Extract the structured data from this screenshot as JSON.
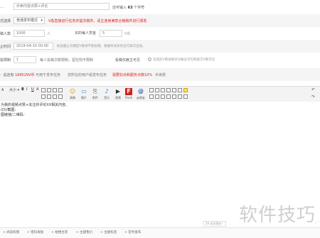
{
  "form": {
    "title_row": {
      "label": "…",
      "value": "外卖内容点赞+评论",
      "counter_prefix": "还可输入",
      "counter_value": "63",
      "counter_suffix": "个字符"
    },
    "mode_row": {
      "label": "式选择",
      "select_value": "普通发布模式",
      "warning": "V看直接进行任务并提交稿件，请主连续满意合格稿件进行颁发"
    },
    "count_row": {
      "label": "稿人数",
      "input_value": "1000",
      "unit": "人",
      "reward_label": "买的每人赏金",
      "reward_value": "5",
      "reward_unit": "V币"
    },
    "deadline_row": {
      "label": "止时间",
      "input_value": "2019-04-10 00:00",
      "note": "如此截止日期后V看将不能投稿，看截时间未有任可再次追加。"
    },
    "limit_row": {
      "label": "投限制",
      "input_value": "1",
      "note": "每人投稿次数限制，留空则不限制",
      "option_label": "投稿仅雇主可见",
      "option_note": "勾选后V看投稿仅对雇主可见和提交V看可见"
    },
    "fee_row": {
      "label": "总还有",
      "amount": "168529V币",
      "amount_note": "可用于发布任务",
      "fee_note": "您所在的用户组发布任务",
      "fee_red": "需要扣点和服务点数10%",
      "fee_tail": "手续费"
    }
  },
  "toolbar": {
    "row1": [
      "大小",
      "B",
      "I",
      "U",
      "A",
      "≡",
      "≡",
      "≡",
      "≡",
      "⁝",
      "≡",
      "🔗",
      "♪",
      "▦",
      "☻"
    ],
    "big_items": [
      {
        "icon_name": "emoji-icon",
        "glyph": "☺",
        "label": "表情"
      },
      {
        "icon_name": "image-icon",
        "glyph": "▭",
        "label": "图片"
      },
      {
        "icon_name": "attachment-icon",
        "glyph": "⎘",
        "label": "附件"
      },
      {
        "icon_name": "music-icon",
        "glyph": "♪",
        "label": "音乐"
      },
      {
        "icon_name": "video-icon",
        "glyph": "▶",
        "label": "视频"
      },
      {
        "icon_name": "flash-icon",
        "glyph": "F",
        "label": "Flash"
      },
      {
        "icon_name": "at-icon",
        "glyph": "@",
        "label": "@朋友"
      }
    ]
  },
  "editor": {
    "lines": [
      "为我的视频点赞+关注并评论XX相关内容。",
      "(D)/截图：",
      "图链接/二维码："
    ]
  },
  "status": {
    "counter": "10 长应答应！"
  },
  "bottom_tags": [
    "+ 阅读权限",
    "+ 密码发贴",
    "+ 给楼主赏",
    "+ 主题售价",
    "+ 主题标签",
    "+ 定时发布"
  ],
  "watermark": "软件技巧"
}
